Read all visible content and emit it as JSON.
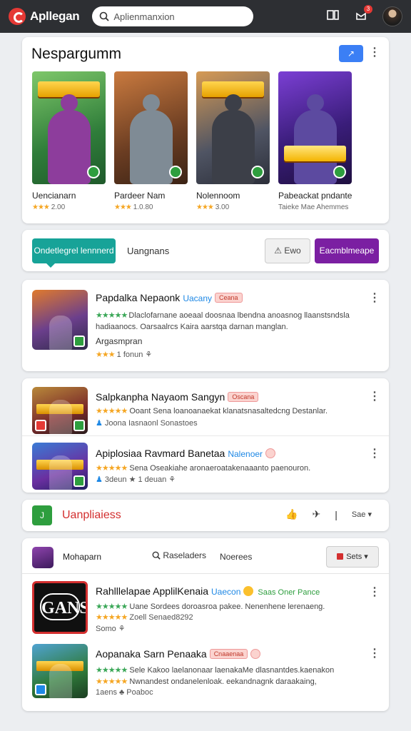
{
  "topbar": {
    "brand": "Apllegan",
    "search_placeholder": "Aplienmanxion",
    "notif_count": "3"
  },
  "featured": {
    "title": "Nespargumm",
    "action_icon": "↗",
    "games": [
      {
        "name": "Uencianarn",
        "stars": "★★★",
        "meta": "2.00"
      },
      {
        "name": "Pardeer Nam",
        "stars": "★★★",
        "meta": "1.0.80"
      },
      {
        "name": "Nolennoom",
        "stars": "★★★",
        "meta": "3.00"
      },
      {
        "name": "Pabeackat pndante",
        "stars": "",
        "meta": "Taieke  Mae  Ahemmes"
      }
    ]
  },
  "filters": {
    "tab_active": "Ondetlegrel lennnerd",
    "tab_2": "Uangnans",
    "filter_btn": "Ewo",
    "primary_btn": "Eacmblmeape"
  },
  "list_a": {
    "title": "Papdalka Nepaonk",
    "tag_blue": "Uacany",
    "tag_red": "Ceana",
    "desc": "Dlaclofarnane aoeaal doosnaa lbendna anoasnog llaanstsndsla hadiaanocs. Oarsaalrcs Kaira aarstqa darnan manglan.",
    "sub": "Argasmpran",
    "stars": "★★★",
    "meta": "1 fonun ⚘"
  },
  "list_b": [
    {
      "title": "Salpkanpha Nayaom Sangyn",
      "tag_red": "Oscana",
      "stars": "★★★★★",
      "desc": "Ooant  Sena  loanoanaekat klanatsnasaltedcng Destanlar.",
      "meta": "Joona   Iasnaonl Sonastoes"
    },
    {
      "title": "Apiplosiaa Ravmard Banetaa",
      "tag_blue": "Nalenoer",
      "stars": "★★★★★",
      "desc": "Sena  Oseakiahe aronaeroatakenaaanto paenouron.",
      "meta": "3deun ★ 1 deuan ⚘"
    }
  ],
  "toolbar": {
    "icon_text": "J",
    "title": "Uanpliaiess",
    "sort_label": "Sae"
  },
  "section": {
    "title": "Mohaparn",
    "search_label": "Raseladers",
    "tab_label": "Noerees",
    "btn_label": "Sets",
    "items": [
      {
        "title": "Rahlllelapae ApplilKenaia",
        "tag_blue": "Uaecon",
        "tag_green": "Saas Oner Pance",
        "stars_g": "★★★★★",
        "desc": "Uane  Sordees doroasroa pakee. Nenenhene lerenaeng.",
        "stars_o": "★★★★★",
        "meta_a": "Zoell  Senaed8292",
        "meta_b": "Somo ⚘",
        "glyph": "GANSO"
      },
      {
        "title": "Aopanaka Sarn Penaaka",
        "tag_red": "Cnaaenaa",
        "stars_g": "★★★★★",
        "desc": "Sele Kakoo  laelanonaar laenakaMe dlasnantdes.kaenakon",
        "stars_o": "★★★★★",
        "desc2": "Nwnandest  ondanelenloak.  eekandnagnk daraakaing,",
        "meta": "1aens  ♣ Poaboc"
      }
    ]
  },
  "colors": {
    "topbar": "#2d2f33",
    "teal": "#17a398",
    "purple": "#7b1fa2",
    "red": "#d32f2f",
    "star": "#f5a623",
    "green_star": "#3aa757"
  },
  "icons": [
    "logo-icon",
    "search-icon",
    "bookmark-icon",
    "inbox-icon",
    "kebab-icon",
    "share-icon",
    "filter-icon",
    "thumb-up-icon",
    "pin-icon",
    "chevron-down-icon"
  ]
}
